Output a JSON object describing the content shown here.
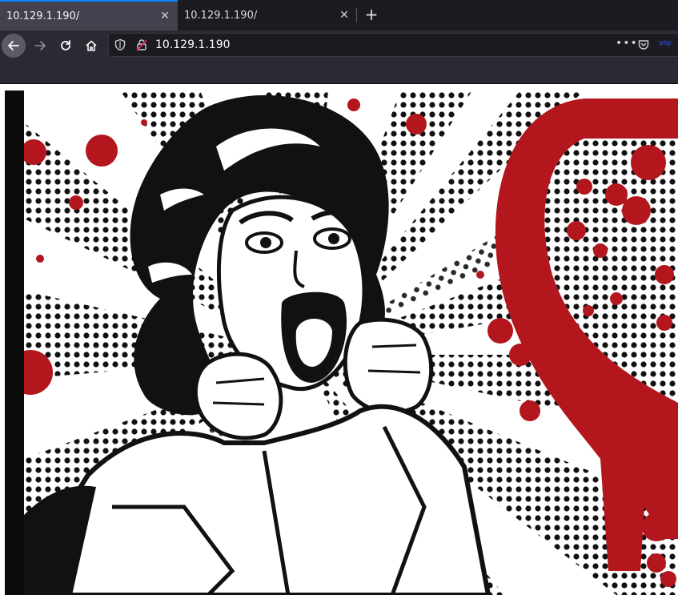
{
  "tabs": [
    {
      "title": "10.129.1.190/",
      "active": true
    },
    {
      "title": "10.129.1.190/",
      "active": false
    }
  ],
  "toolbar": {
    "close_glyph": "✕",
    "new_tab_glyph": "+",
    "more_glyph": "•••",
    "extension_label": "php"
  },
  "urlbar": {
    "url": "10.129.1.190"
  },
  "icons": {
    "back": "back-arrow-icon",
    "forward": "forward-arrow-icon",
    "reload": "reload-icon",
    "home": "home-icon",
    "shield": "tracking-shield-icon",
    "insecure": "insecure-lock-icon",
    "pocket": "pocket-icon"
  },
  "colors": {
    "accent": "#0a84ff",
    "blood_red": "#b3161c",
    "ink": "#111111"
  }
}
